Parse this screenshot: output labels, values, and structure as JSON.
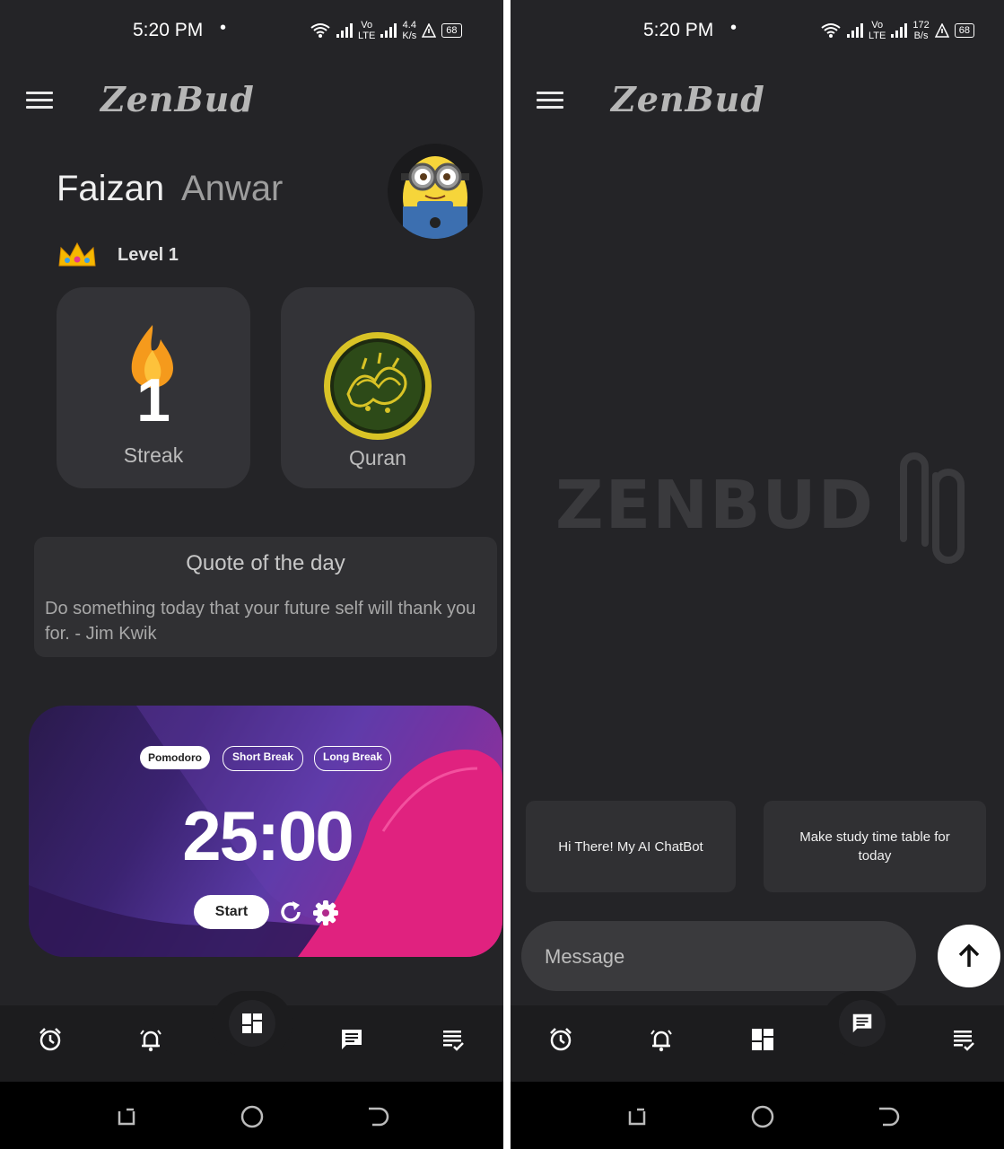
{
  "left_screen": {
    "status_bar": {
      "time": "5:20 PM",
      "speed_value": "4.4",
      "speed_unit": "K/s",
      "battery": "68"
    },
    "app_title": "ZenBud",
    "user": {
      "first_name": "Faizan",
      "last_name": "Anwar",
      "level": "Level 1"
    },
    "cards": {
      "streak_number": "1",
      "streak_label": "Streak",
      "quran_label": "Quran"
    },
    "quote": {
      "title": "Quote of the day",
      "text": "Do something today that your future self will thank you for. - Jim Kwik"
    },
    "timer": {
      "modes": [
        "Pomodoro",
        "Short Break",
        "Long Break"
      ],
      "active_mode": "Pomodoro",
      "time": "25:00",
      "start_label": "Start"
    },
    "bottom_nav": {
      "items": [
        "alarm-icon",
        "notification-icon",
        "dashboard-icon",
        "chat-icon",
        "notes-icon"
      ],
      "active": "dashboard-icon"
    }
  },
  "right_screen": {
    "status_bar": {
      "time": "5:20 PM",
      "speed_value": "172",
      "speed_unit": "B/s",
      "battery": "68"
    },
    "app_title": "ZenBud",
    "watermark": "ZENBUD",
    "suggestions": [
      "Hi There! My AI ChatBot",
      "Make study time table for today"
    ],
    "message_placeholder": "Message",
    "bottom_nav": {
      "items": [
        "alarm-icon",
        "notification-icon",
        "dashboard-icon",
        "chat-icon",
        "notes-icon"
      ],
      "active": "chat-icon"
    }
  },
  "colors": {
    "background": "#242427",
    "card": "#333337",
    "navbar": "#1c1c1e",
    "streak_flame": "#f59a1c",
    "quran_gold": "#d9c326",
    "timer_pink": "#e0227f"
  }
}
